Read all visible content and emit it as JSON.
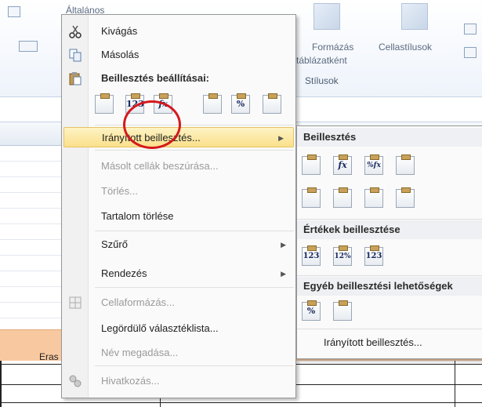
{
  "ribbon": {
    "number_format": "Általános",
    "format_as_table": "Formázás",
    "format_as_table_line2": "táblázatként",
    "cell_styles": "Cellastílusok",
    "group_styles": "Stílusok"
  },
  "sheet": {
    "cell_text": "Eras"
  },
  "context_menu": {
    "cut": "Kivágás",
    "copy": "Másolás",
    "paste_options": "Beillesztés beállításai:",
    "paste_special": "Irányított beillesztés...",
    "insert_copied": "Másolt cellák beszúrása...",
    "delete": "Törlés...",
    "clear_contents": "Tartalom törlése",
    "filter": "Szűrő",
    "sort": "Rendezés",
    "format_cells": "Cellaformázás...",
    "dropdown_list": "Legördülő választéklista...",
    "define_name": "Név megadása...",
    "hyperlink": "Hivatkozás..."
  },
  "paste_buttons": [
    "",
    "123",
    "fx",
    "",
    "%",
    ""
  ],
  "submenu": {
    "paste_header": "Beillesztés",
    "values_header": "Értékek beillesztése",
    "other_header": "Egyéb beillesztési lehetőségek",
    "paste_special_link": "Irányított beillesztés...",
    "paste_buttons": [
      "",
      "fx",
      "%fx",
      ""
    ],
    "paste_buttons_row2": [
      "",
      "",
      "",
      ""
    ],
    "value_buttons": [
      "123",
      "12%",
      "123"
    ],
    "other_buttons": [
      "%",
      ""
    ]
  },
  "colors": {
    "highlight": "#fbe08b",
    "circle": "#d4191d"
  }
}
